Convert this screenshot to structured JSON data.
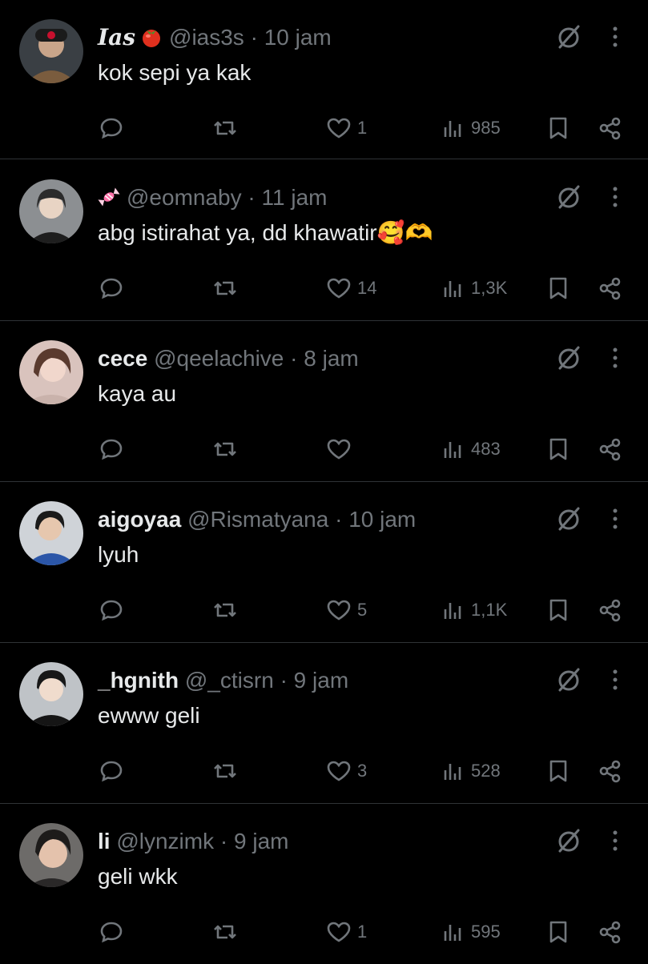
{
  "replies": [
    {
      "name": "Ias",
      "handle": "@ias3s",
      "time": "10 jam",
      "text": "kok sepi ya kak",
      "likes": "1",
      "views": "985",
      "badge": "tomato-emoji"
    },
    {
      "name": "",
      "handle": "@eomnaby",
      "time": "11 jam",
      "text": "abg istirahat ya, dd khawatir🥰🫶",
      "likes": "14",
      "views": "1,3K",
      "badge": "candy-emoji"
    },
    {
      "name": "cece",
      "handle": "@qeelachive",
      "time": "8 jam",
      "text": "kaya au",
      "likes": "",
      "views": "483"
    },
    {
      "name": "aigoyaa",
      "handle": "@Rismatyana",
      "time": "10 jam",
      "text": "lyuh",
      "likes": "5",
      "views": "1,1K"
    },
    {
      "name": "_hgnith",
      "handle": "@_ctisrn",
      "time": "9 jam",
      "text": "ewww geli",
      "likes": "3",
      "views": "528"
    },
    {
      "name": "li",
      "handle": "@lynzimk",
      "time": "9 jam",
      "text": "geli wkk",
      "likes": "1",
      "views": "595"
    }
  ],
  "separator": "·",
  "icons": [
    "reply-icon",
    "retweet-icon",
    "heart-icon",
    "views-icon",
    "bookmark-icon",
    "share-icon",
    "grok-icon",
    "more-icon"
  ],
  "colors": {
    "background": "#000000",
    "text": "#e7e9ea",
    "secondary": "#71767b",
    "divider": "#2f3336"
  }
}
